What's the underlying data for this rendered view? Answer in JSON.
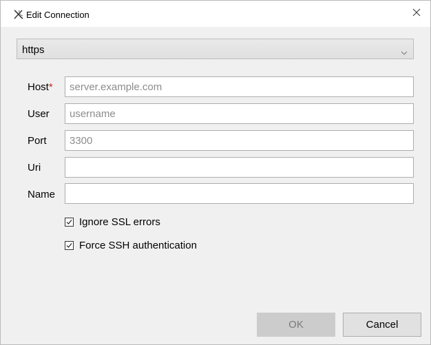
{
  "window": {
    "title": "Edit Connection",
    "icon": "x-app-icon",
    "close_icon": "close-icon"
  },
  "protocol_dropdown": {
    "selected": "https",
    "icon": "chevron-down-icon"
  },
  "form": {
    "host": {
      "label": "Host",
      "required_mark": "*",
      "value": "",
      "placeholder": "server.example.com"
    },
    "user": {
      "label": "User",
      "value": "",
      "placeholder": "username"
    },
    "port": {
      "label": "Port",
      "value": "",
      "placeholder": "3300"
    },
    "uri": {
      "label": "Uri",
      "value": "",
      "placeholder": ""
    },
    "name": {
      "label": "Name",
      "value": "",
      "placeholder": ""
    }
  },
  "options": {
    "ignore_ssl": {
      "label": "Ignore SSL errors",
      "checked": true
    },
    "force_ssh": {
      "label": "Force SSH authentication",
      "checked": true
    }
  },
  "buttons": {
    "ok": {
      "label": "OK",
      "enabled": false
    },
    "cancel": {
      "label": "Cancel",
      "enabled": true
    }
  },
  "colors": {
    "required": "#c42b1c",
    "background": "#f0f0f0",
    "disabled_button": "#cccccc"
  }
}
